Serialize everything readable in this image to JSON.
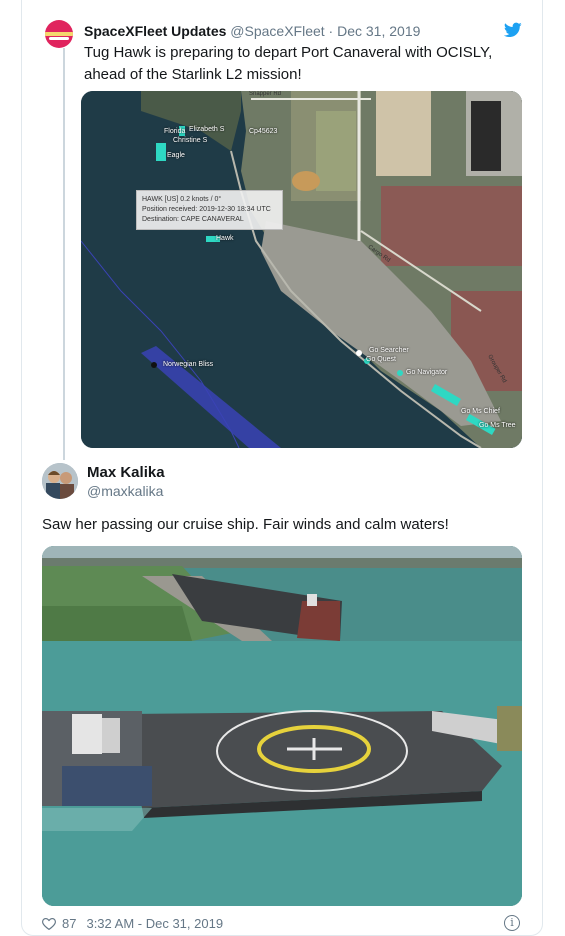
{
  "quoted_tweet": {
    "display_name": "SpaceXFleet Updates",
    "handle": "@SpaceXFleet",
    "separator": "·",
    "date": "Dec 31, 2019",
    "text": "Tug Hawk is preparing to depart Port Canaveral with OCISLY, ahead of the Starlink L2 mission!",
    "map": {
      "vessel_labels": [
        "Florida",
        "Elizabeth S",
        "Christine S",
        "Eagle",
        "Hawk",
        "Norwegian Bliss",
        "Go Searcher",
        "Go Quest",
        "Go Navigator",
        "Go Ms Chief",
        "Go Ms Tree"
      ],
      "misc_label": "Cp45623",
      "popup": {
        "line1": "HAWK [US] 0.2 knots / 0°",
        "line2": "Position received: 2019-12-30 18:34 UTC",
        "line3": "Destination: CAPE CANAVERAL"
      },
      "streets": [
        "Snapper Rd",
        "Cargo Rd",
        "Grouper Rd"
      ],
      "watermarks": [
        "© 2019 Google",
        "© 2019 Google",
        "© 2019 Google"
      ]
    }
  },
  "tweet": {
    "display_name": "Max Kalika",
    "handle": "@maxkalika",
    "text": "Saw her passing our cruise ship. Fair winds and calm waters!",
    "like_count": "87",
    "timestamp": "3:32 AM - Dec 31, 2019"
  },
  "icons": {
    "twitter": "twitter-bird-icon",
    "heart": "heart-icon",
    "info": "info-icon"
  },
  "colors": {
    "twitter_blue": "#1da1f2",
    "muted": "#657786",
    "border": "#e1e8ed",
    "map_water": "#1f3b47",
    "vessel_marker": "#2ed8c3",
    "ship_route": "#3a43b5"
  }
}
